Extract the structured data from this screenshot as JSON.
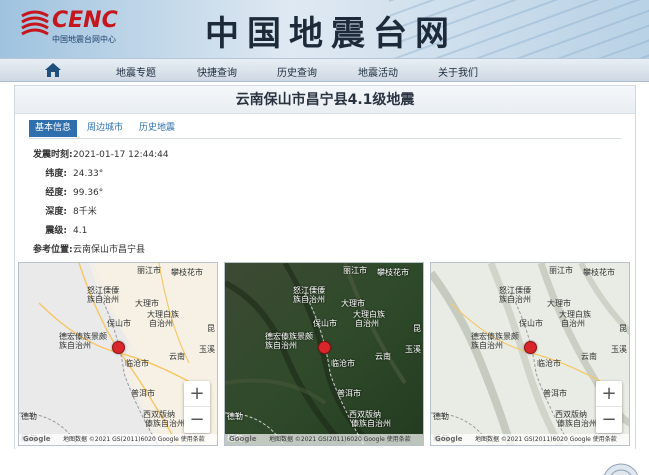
{
  "header": {
    "logo_text": "CENC",
    "logo_subtitle": "中国地震台网中心",
    "site_title": "中国地震台网"
  },
  "nav": {
    "home_icon": "home-icon",
    "items": [
      "地震专题",
      "快捷查询",
      "历史查询",
      "地震活动",
      "关于我们"
    ]
  },
  "event": {
    "title": "云南保山市昌宁县4.1级地震",
    "tabs": [
      "基本信息",
      "周边城市",
      "历史地震"
    ],
    "active_tab": "基本信息",
    "fields": [
      {
        "label": "发震时刻:",
        "value": "2021-01-17 12:44:44"
      },
      {
        "label": "纬度:",
        "value": "24.33°"
      },
      {
        "label": "经度:",
        "value": "99.36°"
      },
      {
        "label": "深度:",
        "value": "8千米"
      },
      {
        "label": "震级:",
        "value": "4.1"
      },
      {
        "label": "参考位置:",
        "value": "云南保山市昌宁县"
      }
    ]
  },
  "maps": [
    {
      "style": "roadmap",
      "labels": [
        "丽江市",
        "攀枝花市",
        "怒江傈僳",
        "族自治州",
        "大理市",
        "大理白族",
        "自治州",
        "德宏傣族景颇",
        "族自治州",
        "保山市",
        "临沧市",
        "云南",
        "玉溪",
        "昆",
        "普洱市",
        "西双版纳",
        "傣族自治州",
        "德勒",
        "缅甸"
      ],
      "zoom_in": "+",
      "zoom_out": "−",
      "attribution": "地图数据 ©2021 GS(2011)6020 Google   使用条款",
      "google": "Google"
    },
    {
      "style": "satellite",
      "labels": [
        "丽江市",
        "攀枝花市",
        "怒江傈僳",
        "族自治州",
        "大理市",
        "大理白族",
        "自治州",
        "德宏傣族景颇",
        "族自治州",
        "保山市",
        "临沧市",
        "云南",
        "玉溪",
        "昆",
        "普洱市",
        "西双版纳",
        "傣族自治州",
        "德勒",
        "缅甸"
      ],
      "zoom_in": "+",
      "zoom_out": "−",
      "attribution": "地图数据 ©2021 GS(2011)6020 Google   使用条款",
      "google": "Google"
    },
    {
      "style": "terrain",
      "labels": [
        "丽江市",
        "攀枝花市",
        "怒江傈僳",
        "族自治州",
        "大理市",
        "大理白族",
        "自治州",
        "德宏傣族景颇",
        "族自治州",
        "保山市",
        "临沧市",
        "云南",
        "玉溪",
        "昆",
        "普洱市",
        "西双版纳",
        "傣族自治州",
        "德勒",
        "缅甸"
      ],
      "zoom_in": "+",
      "zoom_out": "−",
      "attribution": "地图数据 ©2021 GS(2011)6020 Google   使用条款",
      "google": "Google"
    }
  ],
  "colors": {
    "brand_red": "#c4161c",
    "tab_active": "#2f6fad",
    "epicenter": "#d9262c"
  }
}
